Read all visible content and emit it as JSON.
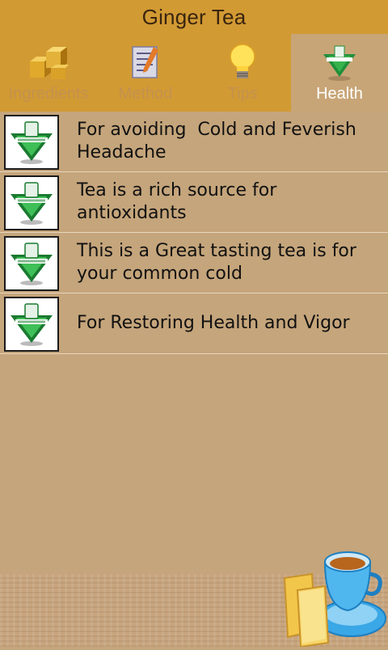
{
  "app": {
    "title": "Ginger Tea"
  },
  "tabs": [
    {
      "label": "Ingredients",
      "icon": "boxes-icon",
      "active": false
    },
    {
      "label": "Method",
      "icon": "notepad-icon",
      "active": false
    },
    {
      "label": "Tips",
      "icon": "lightbulb-icon",
      "active": false
    },
    {
      "label": "Health",
      "icon": "health-emblem-icon",
      "active": true
    }
  ],
  "health_items": [
    {
      "text": "For avoiding  Cold and Feverish Headache",
      "icon": "health-emblem-icon"
    },
    {
      "text": "Tea is a rich source for antioxidants",
      "icon": "health-emblem-icon"
    },
    {
      "text": "This is a Great tasting tea is for your common cold",
      "icon": "health-emblem-icon"
    },
    {
      "text": "For Restoring Health and Vigor",
      "icon": "health-emblem-icon"
    }
  ],
  "colors": {
    "header": "#d29a33",
    "background": "#c5a57b",
    "active_tab": "#c8a576",
    "inactive_tab_text": "#c3924e",
    "active_tab_text": "#ffffff"
  },
  "decor": {
    "footer_image": "teacup-with-toast-icon"
  }
}
